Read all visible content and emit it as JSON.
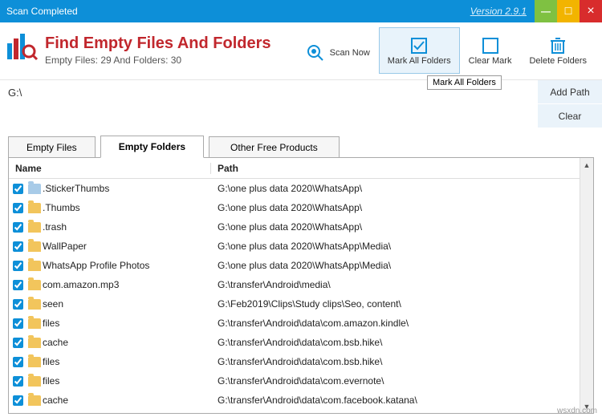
{
  "window": {
    "title": "Scan Completed",
    "version": "Version 2.9.1"
  },
  "brand": {
    "title": "Find Empty Files And Folders",
    "subtitle": "Empty Files: 29 And Folders: 30"
  },
  "toolbar": {
    "scan_now": "Scan Now",
    "mark_all_folders": "Mark All Folders",
    "clear_mark": "Clear Mark",
    "delete_folders": "Delete Folders",
    "tooltip": "Mark All Folders"
  },
  "path": "G:\\",
  "side": {
    "add_path": "Add Path",
    "clear": "Clear"
  },
  "tabs": {
    "empty_files": "Empty Files",
    "empty_folders": "Empty Folders",
    "other": "Other Free Products"
  },
  "table": {
    "col_name": "Name",
    "col_path": "Path",
    "rows": [
      {
        "name": ".StickerThumbs",
        "path": "G:\\one plus data 2020\\WhatsApp\\",
        "blue": true
      },
      {
        "name": ".Thumbs",
        "path": "G:\\one plus data 2020\\WhatsApp\\"
      },
      {
        "name": ".trash",
        "path": "G:\\one plus data 2020\\WhatsApp\\"
      },
      {
        "name": "WallPaper",
        "path": "G:\\one plus data 2020\\WhatsApp\\Media\\"
      },
      {
        "name": "WhatsApp Profile Photos",
        "path": "G:\\one plus data 2020\\WhatsApp\\Media\\"
      },
      {
        "name": "com.amazon.mp3",
        "path": "G:\\transfer\\Android\\media\\"
      },
      {
        "name": "seen",
        "path": "G:\\Feb2019\\Clips\\Study clips\\Seo, content\\"
      },
      {
        "name": "files",
        "path": "G:\\transfer\\Android\\data\\com.amazon.kindle\\"
      },
      {
        "name": "cache",
        "path": "G:\\transfer\\Android\\data\\com.bsb.hike\\"
      },
      {
        "name": "files",
        "path": "G:\\transfer\\Android\\data\\com.bsb.hike\\"
      },
      {
        "name": "files",
        "path": "G:\\transfer\\Android\\data\\com.evernote\\"
      },
      {
        "name": "cache",
        "path": "G:\\transfer\\Android\\data\\com.facebook.katana\\"
      }
    ]
  },
  "watermark": "wsxdn.com"
}
